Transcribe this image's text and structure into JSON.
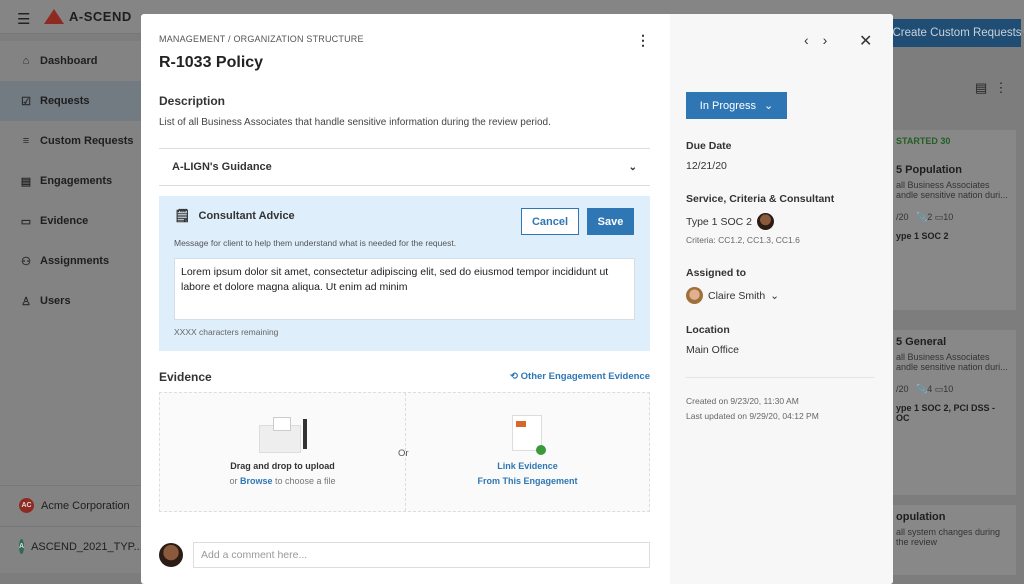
{
  "app": {
    "name": "A-SCEND"
  },
  "sidebar": {
    "items": [
      {
        "label": "Dashboard",
        "icon": "home-icon"
      },
      {
        "label": "Requests",
        "icon": "checkbox-icon"
      },
      {
        "label": "Custom Requests",
        "icon": "list-add-icon"
      },
      {
        "label": "Engagements",
        "icon": "document-icon"
      },
      {
        "label": "Evidence",
        "icon": "folder-icon"
      },
      {
        "label": "Assignments",
        "icon": "people-icon"
      },
      {
        "label": "Users",
        "icon": "user-icon"
      }
    ],
    "orgs": [
      {
        "badge": "AC",
        "label": "Acme Corporation",
        "color": "#d83a2e"
      },
      {
        "badge": "A",
        "label": "ASCEND_2021_TYP...",
        "color": "#3f9a82"
      }
    ]
  },
  "background": {
    "create_button": "Create Custom Requests",
    "column_header": "STARTED",
    "column_count": "30",
    "cards": [
      {
        "title": "5 Population",
        "desc": "all Business Associates andle sensitive nation duri...",
        "date": "/20",
        "attachments": "2",
        "comments": "10",
        "service": "ype 1 SOC 2"
      },
      {
        "title": "5 General",
        "desc": "all Business Associates andle sensitive nation duri...",
        "date": "/20",
        "attachments": "4",
        "comments": "10",
        "service": "ype 1 SOC 2, PCI DSS - OC"
      },
      {
        "title": "opulation",
        "desc": "all system changes during the review"
      }
    ]
  },
  "modal": {
    "breadcrumb": "MANAGEMENT / ORGANIZATION STRUCTURE",
    "title": "R-1033 Policy",
    "description_heading": "Description",
    "description": "List of all Business Associates that handle sensitive information during the review period.",
    "guidance": "A-LIGN's Guidance",
    "advice": {
      "title": "Consultant Advice",
      "message": "Message for client to help them understand what is needed for the request.",
      "cancel": "Cancel",
      "save": "Save",
      "text": "Lorem ipsum dolor sit amet, consectetur adipiscing elit, sed do eiusmod tempor incididunt ut labore et dolore magna aliqua. Ut enim ad minim",
      "remaining": "XXXX characters remaining"
    },
    "evidence": {
      "heading": "Evidence",
      "other_link": "Other Engagement Evidence",
      "drag": "Drag and drop to upload",
      "or_prefix": "or",
      "browse": "Browse",
      "browse_suffix": "to choose a file",
      "or": "Or",
      "link1": "Link Evidence",
      "link2": "From This Engagement"
    },
    "comment_placeholder": "Add a comment here...",
    "side": {
      "status": "In Progress",
      "due_label": "Due Date",
      "due": "12/21/20",
      "service_label": "Service, Criteria & Consultant",
      "service": "Type 1 SOC 2",
      "criteria": "Criteria: CC1.2, CC1.3, CC1.6",
      "assigned_label": "Assigned to",
      "assigned": "Claire Smith",
      "location_label": "Location",
      "location": "Main Office",
      "created": "Created on 9/23/20, 11:30 AM",
      "updated": "Last updated on 9/29/20, 04:12 PM"
    }
  },
  "colors": {
    "primary": "#2f77b4",
    "brand": "#d83a2e",
    "advice_bg": "#deeefb"
  }
}
